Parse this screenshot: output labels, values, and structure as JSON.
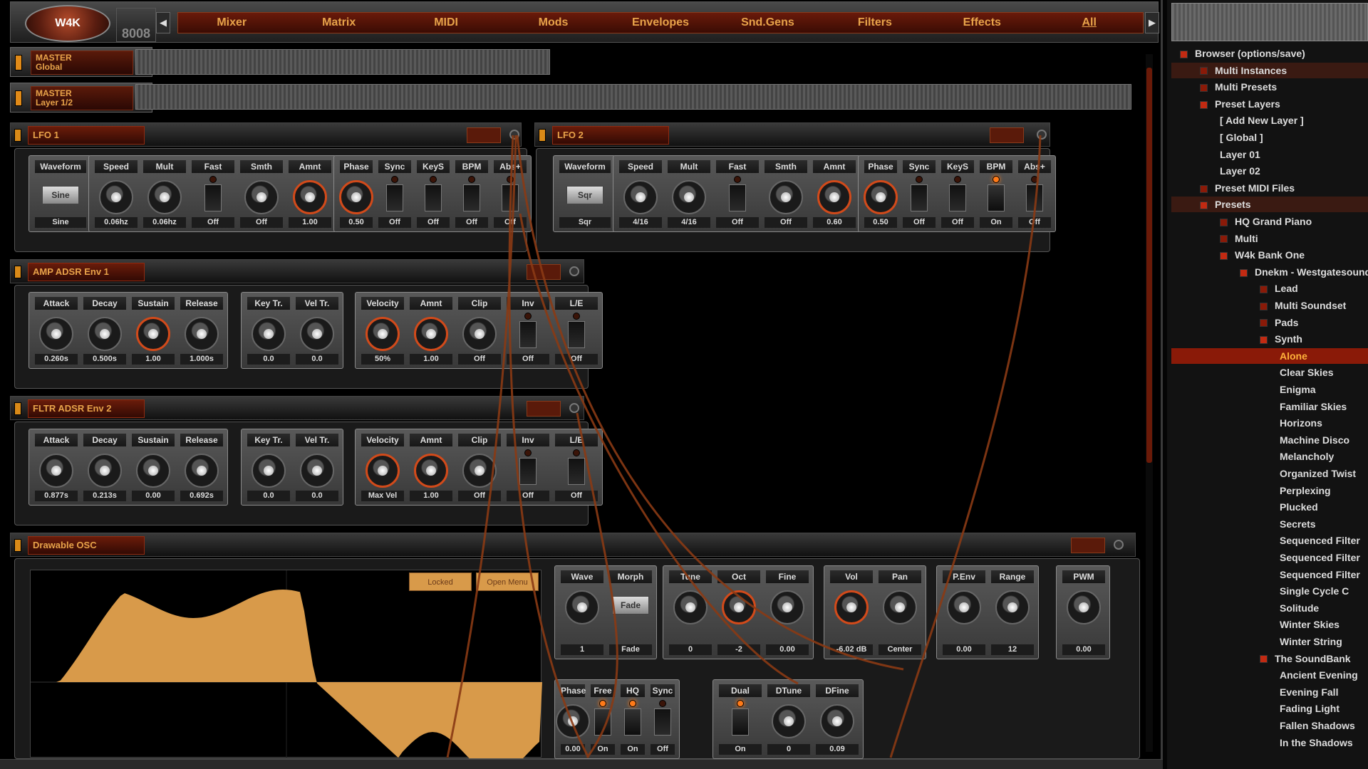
{
  "nav": {
    "items": [
      "Mixer",
      "Matrix",
      "MIDI",
      "Mods",
      "Envelopes",
      "Snd.Gens",
      "Filters",
      "Effects",
      "All"
    ],
    "active": "All",
    "prev": "◀",
    "next": "▶"
  },
  "logo": {
    "main": "W4K",
    "sub": "8008"
  },
  "master_global": {
    "title": "MASTER",
    "sub": "Global"
  },
  "master_layer": {
    "title": "MASTER",
    "sub": "Layer 1/2"
  },
  "lfo1": {
    "title": "LFO 1",
    "cells": [
      {
        "label": "Waveform",
        "type": "select",
        "select": "Sine",
        "value": "Sine"
      },
      {
        "label": "Speed",
        "type": "knob",
        "value": "0.06hz"
      },
      {
        "label": "Mult",
        "type": "knob",
        "value": "0.06hz"
      },
      {
        "label": "Fast",
        "type": "toggle",
        "value": "Off"
      },
      {
        "label": "Smth",
        "type": "knob",
        "value": "Off"
      },
      {
        "label": "Amnt",
        "type": "knob",
        "red": true,
        "value": "1.00"
      },
      {
        "label": "Phase",
        "type": "knob",
        "red": true,
        "value": "0.50"
      },
      {
        "label": "Sync",
        "type": "toggle",
        "value": "Off"
      },
      {
        "label": "KeyS",
        "type": "toggle",
        "value": "Off"
      },
      {
        "label": "BPM",
        "type": "toggle",
        "value": "Off"
      },
      {
        "label": "Abs+",
        "type": "toggle",
        "value": "Off"
      }
    ]
  },
  "lfo2": {
    "title": "LFO 2",
    "cells": [
      {
        "label": "Waveform",
        "type": "select",
        "select": "Sqr",
        "value": "Sqr"
      },
      {
        "label": "Speed",
        "type": "knob",
        "value": "4/16"
      },
      {
        "label": "Mult",
        "type": "knob",
        "value": "4/16"
      },
      {
        "label": "Fast",
        "type": "toggle",
        "value": "Off"
      },
      {
        "label": "Smth",
        "type": "knob",
        "value": "Off"
      },
      {
        "label": "Amnt",
        "type": "knob",
        "red": true,
        "value": "0.60"
      },
      {
        "label": "Phase",
        "type": "knob",
        "red": true,
        "value": "0.50"
      },
      {
        "label": "Sync",
        "type": "toggle",
        "value": "Off"
      },
      {
        "label": "KeyS",
        "type": "toggle",
        "value": "Off"
      },
      {
        "label": "BPM",
        "type": "toggle",
        "on": true,
        "value": "On"
      },
      {
        "label": "Abs+",
        "type": "toggle",
        "value": "Off"
      }
    ]
  },
  "amp": {
    "title": "AMP ADSR Env 1",
    "cells": [
      {
        "label": "Attack",
        "type": "knob",
        "value": "0.260s"
      },
      {
        "label": "Decay",
        "type": "knob",
        "value": "0.500s"
      },
      {
        "label": "Sustain",
        "type": "knob",
        "red": true,
        "value": "1.00"
      },
      {
        "label": "Release",
        "type": "knob",
        "value": "1.000s"
      },
      {
        "label": "Key Tr.",
        "type": "knob",
        "value": "0.0"
      },
      {
        "label": "Vel Tr.",
        "type": "knob",
        "value": "0.0"
      },
      {
        "label": "Velocity",
        "type": "knob",
        "red": true,
        "value": "50%"
      },
      {
        "label": "Amnt",
        "type": "knob",
        "red": true,
        "value": "1.00"
      },
      {
        "label": "Clip",
        "type": "knob",
        "value": "Off"
      },
      {
        "label": "Inv",
        "type": "toggle",
        "value": "Off"
      },
      {
        "label": "L/E",
        "type": "toggle",
        "value": "Off"
      }
    ]
  },
  "fltr": {
    "title": "FLTR ADSR Env 2",
    "cells": [
      {
        "label": "Attack",
        "type": "knob",
        "value": "0.877s"
      },
      {
        "label": "Decay",
        "type": "knob",
        "value": "0.213s"
      },
      {
        "label": "Sustain",
        "type": "knob",
        "value": "0.00"
      },
      {
        "label": "Release",
        "type": "knob",
        "value": "0.692s"
      },
      {
        "label": "Key Tr.",
        "type": "knob",
        "value": "0.0"
      },
      {
        "label": "Vel Tr.",
        "type": "knob",
        "value": "0.0"
      },
      {
        "label": "Velocity",
        "type": "knob",
        "red": true,
        "value": "Max Vel"
      },
      {
        "label": "Amnt",
        "type": "knob",
        "red": true,
        "value": "1.00"
      },
      {
        "label": "Clip",
        "type": "knob",
        "value": "Off"
      },
      {
        "label": "Inv",
        "type": "toggle",
        "value": "Off"
      },
      {
        "label": "L/E",
        "type": "toggle",
        "value": "Off"
      }
    ]
  },
  "osc": {
    "title": "Drawable OSC",
    "locked": "Locked",
    "open_menu": "Open Menu",
    "cells": [
      {
        "label": "Wave",
        "type": "knob",
        "value": "1"
      },
      {
        "label": "Morph",
        "type": "select",
        "select": "Fade",
        "value": "Fade"
      },
      {
        "label": "Tune",
        "type": "knob",
        "value": "0"
      },
      {
        "label": "Oct",
        "type": "knob",
        "red": true,
        "value": "-2"
      },
      {
        "label": "Fine",
        "type": "knob",
        "value": "0.00"
      },
      {
        "label": "Vol",
        "type": "knob",
        "red": true,
        "value": "-6.02 dB"
      },
      {
        "label": "Pan",
        "type": "knob",
        "value": "Center"
      },
      {
        "label": "P.Env",
        "type": "knob",
        "value": "0.00"
      },
      {
        "label": "Range",
        "type": "knob",
        "value": "12"
      },
      {
        "label": "PWM",
        "type": "knob",
        "value": "0.00"
      }
    ],
    "cells2": [
      {
        "label": "Phase",
        "type": "knob",
        "value": "0.00"
      },
      {
        "label": "Free",
        "type": "toggle",
        "on": true,
        "value": "On"
      },
      {
        "label": "HQ",
        "type": "toggle",
        "on": true,
        "value": "On"
      },
      {
        "label": "Sync",
        "type": "toggle",
        "value": "Off"
      },
      {
        "label": "Dual",
        "type": "toggle",
        "on": true,
        "value": "On"
      },
      {
        "label": "DTune",
        "type": "knob",
        "value": "0"
      },
      {
        "label": "DFine",
        "type": "knob",
        "value": "0.09"
      }
    ]
  },
  "browser": {
    "rows": [
      {
        "t": "Browser (options/save)",
        "d": 0,
        "o": true
      },
      {
        "t": "Multi Instances",
        "d": 1,
        "hl": true
      },
      {
        "t": "Multi Presets",
        "d": 1
      },
      {
        "t": "Preset Layers",
        "d": 1,
        "o": true
      },
      {
        "t": "[ Add New Layer ]",
        "d": 2,
        "n": true
      },
      {
        "t": "[ Global ]",
        "d": 2,
        "n": true
      },
      {
        "t": "Layer 01",
        "d": 2,
        "n": true
      },
      {
        "t": "Layer 02",
        "d": 2,
        "n": true
      },
      {
        "t": "Preset MIDI Files",
        "d": 1
      },
      {
        "t": "Presets",
        "d": 1,
        "o": true,
        "hl": true
      },
      {
        "t": "HQ Grand Piano",
        "d": 2
      },
      {
        "t": "Multi",
        "d": 2
      },
      {
        "t": "W4k Bank One",
        "d": 2,
        "o": true
      },
      {
        "t": "Dnekm - Westgatesound",
        "d": 3,
        "o": true
      },
      {
        "t": "Lead",
        "d": 4
      },
      {
        "t": "Multi Soundset",
        "d": 4
      },
      {
        "t": "Pads",
        "d": 4
      },
      {
        "t": "Synth",
        "d": 4,
        "o": true
      },
      {
        "t": "Alone",
        "d": 5,
        "n": true,
        "sel": true
      },
      {
        "t": "Clear Skies",
        "d": 5,
        "n": true
      },
      {
        "t": "Enigma",
        "d": 5,
        "n": true
      },
      {
        "t": "Familiar Skies",
        "d": 5,
        "n": true
      },
      {
        "t": "Horizons",
        "d": 5,
        "n": true
      },
      {
        "t": "Machine Disco",
        "d": 5,
        "n": true
      },
      {
        "t": "Melancholy",
        "d": 5,
        "n": true
      },
      {
        "t": "Organized Twist",
        "d": 5,
        "n": true
      },
      {
        "t": "Perplexing",
        "d": 5,
        "n": true
      },
      {
        "t": "Plucked",
        "d": 5,
        "n": true
      },
      {
        "t": "Secrets",
        "d": 5,
        "n": true
      },
      {
        "t": "Sequenced Filter",
        "d": 5,
        "n": true
      },
      {
        "t": "Sequenced Filter",
        "d": 5,
        "n": true
      },
      {
        "t": "Sequenced Filter",
        "d": 5,
        "n": true
      },
      {
        "t": "Single Cycle C",
        "d": 5,
        "n": true
      },
      {
        "t": "Solitude",
        "d": 5,
        "n": true
      },
      {
        "t": "Winter Skies",
        "d": 5,
        "n": true
      },
      {
        "t": "Winter String",
        "d": 5,
        "n": true
      },
      {
        "t": "The SoundBank",
        "d": 4,
        "o": true
      },
      {
        "t": "Ancient Evening",
        "d": 5,
        "n": true
      },
      {
        "t": "Evening Fall",
        "d": 5,
        "n": true
      },
      {
        "t": "Fading Light",
        "d": 5,
        "n": true
      },
      {
        "t": "Fallen Shadows",
        "d": 5,
        "n": true
      },
      {
        "t": "In the Shadows",
        "d": 5,
        "n": true
      }
    ]
  },
  "colors": {
    "accent": "#e8a34a",
    "cable": "#8a3a14",
    "wave": "#d89a4a"
  }
}
